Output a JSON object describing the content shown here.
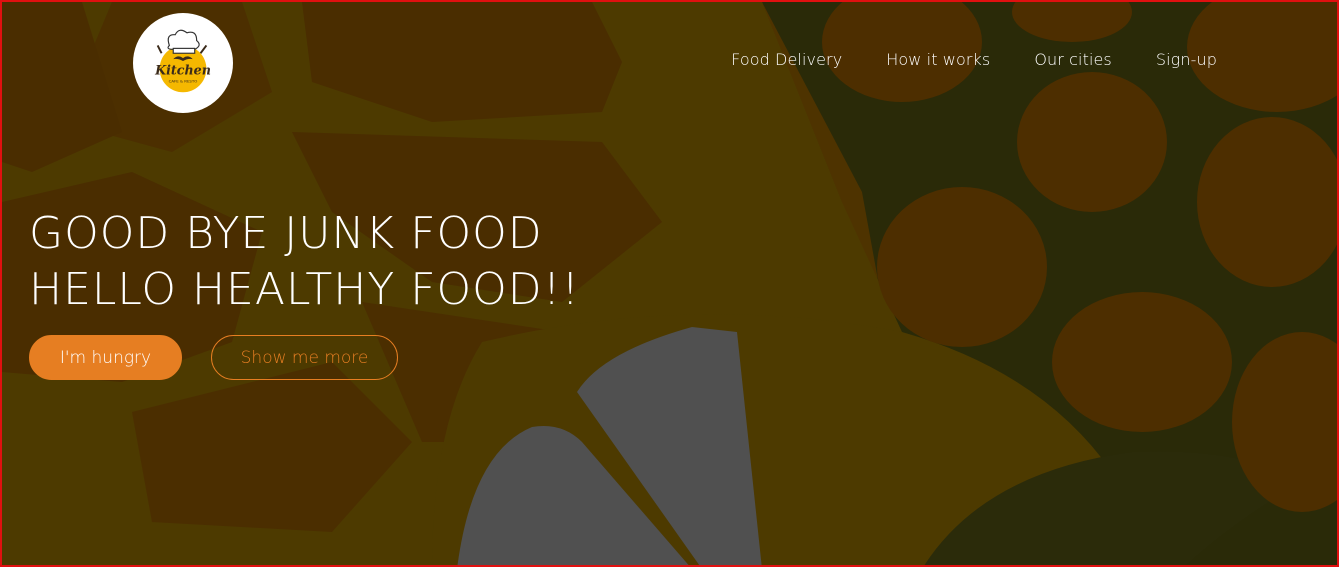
{
  "brand": {
    "logo_word": "Kitchen",
    "logo_tagline": "CAFE & RESTO"
  },
  "nav": {
    "items": [
      {
        "label": "Food Delivery"
      },
      {
        "label": "How it works"
      },
      {
        "label": "Our cities"
      },
      {
        "label": "Sign-up"
      }
    ]
  },
  "hero": {
    "headline_line1": "GOOD BYE JUNK FOOD",
    "headline_line2": "HELLO HEALTHY FOOD!!",
    "primary_button": "I'm hungry",
    "secondary_button": "Show me more"
  },
  "colors": {
    "accent": "#e67e22",
    "text": "#ffffff",
    "overlay_base": "#4d3200",
    "frame_border": "#e01010"
  },
  "icons": {
    "logo": "chef-hat-kitchen-logo"
  }
}
